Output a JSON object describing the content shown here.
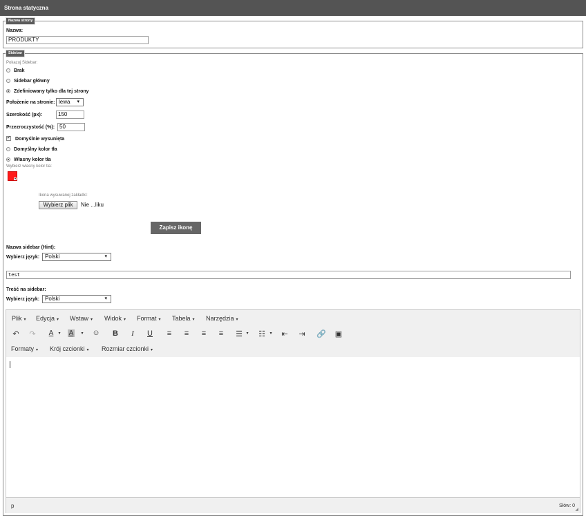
{
  "header": {
    "title": "Strona statyczna"
  },
  "name_section": {
    "legend": "Nazwa strony",
    "label": "Nazwa:",
    "value": "PRODUKTY"
  },
  "sidebar_section": {
    "legend": "Sidebar",
    "show_label": "Pokazuj Sidebar:",
    "options": [
      "Brak",
      "Sidebar główny",
      "Zdefiniowany tylko dla tej strony"
    ],
    "selected_option": 2,
    "position_label": "Położenie na stronie:",
    "position_value": "lewa",
    "width_label": "Szerokość (px):",
    "width_value": "150",
    "opacity_label": "Przezroczystość (%):",
    "opacity_value": "50",
    "expanded_label": "Domyślnie wysunięta",
    "expanded_checked": true,
    "bg_default_label": "Domyślny kolor tła",
    "bg_custom_label": "Własny kolor tła",
    "bg_custom_selected": true,
    "choose_color_label": "Wybierz własny kolor tła:",
    "chosen_color": "#ff1a1a",
    "tab_icon_label": "Ikona wysuwanej zakładki:",
    "file_button": "Wybierz plik",
    "file_status": "Nie ...liku",
    "save_icon_button": "Zapisz ikonę",
    "hint_label": "Nazwa sidebar (Hint):",
    "lang_label_1": "Wybierz język:",
    "lang_value_1": "Polski",
    "hint_value": "test",
    "content_label": "Treść na sidebar:",
    "lang_label_2": "Wybierz język:",
    "lang_value_2": "Polski"
  },
  "editor": {
    "menus": [
      "Plik",
      "Edycja",
      "Wstaw",
      "Widok",
      "Format",
      "Tabela",
      "Narzędzia"
    ],
    "menus2": [
      "Formaty",
      "Krój czcionki",
      "Rozmiar czcionki"
    ],
    "status_path": "p",
    "word_count": "Słów: 0"
  }
}
